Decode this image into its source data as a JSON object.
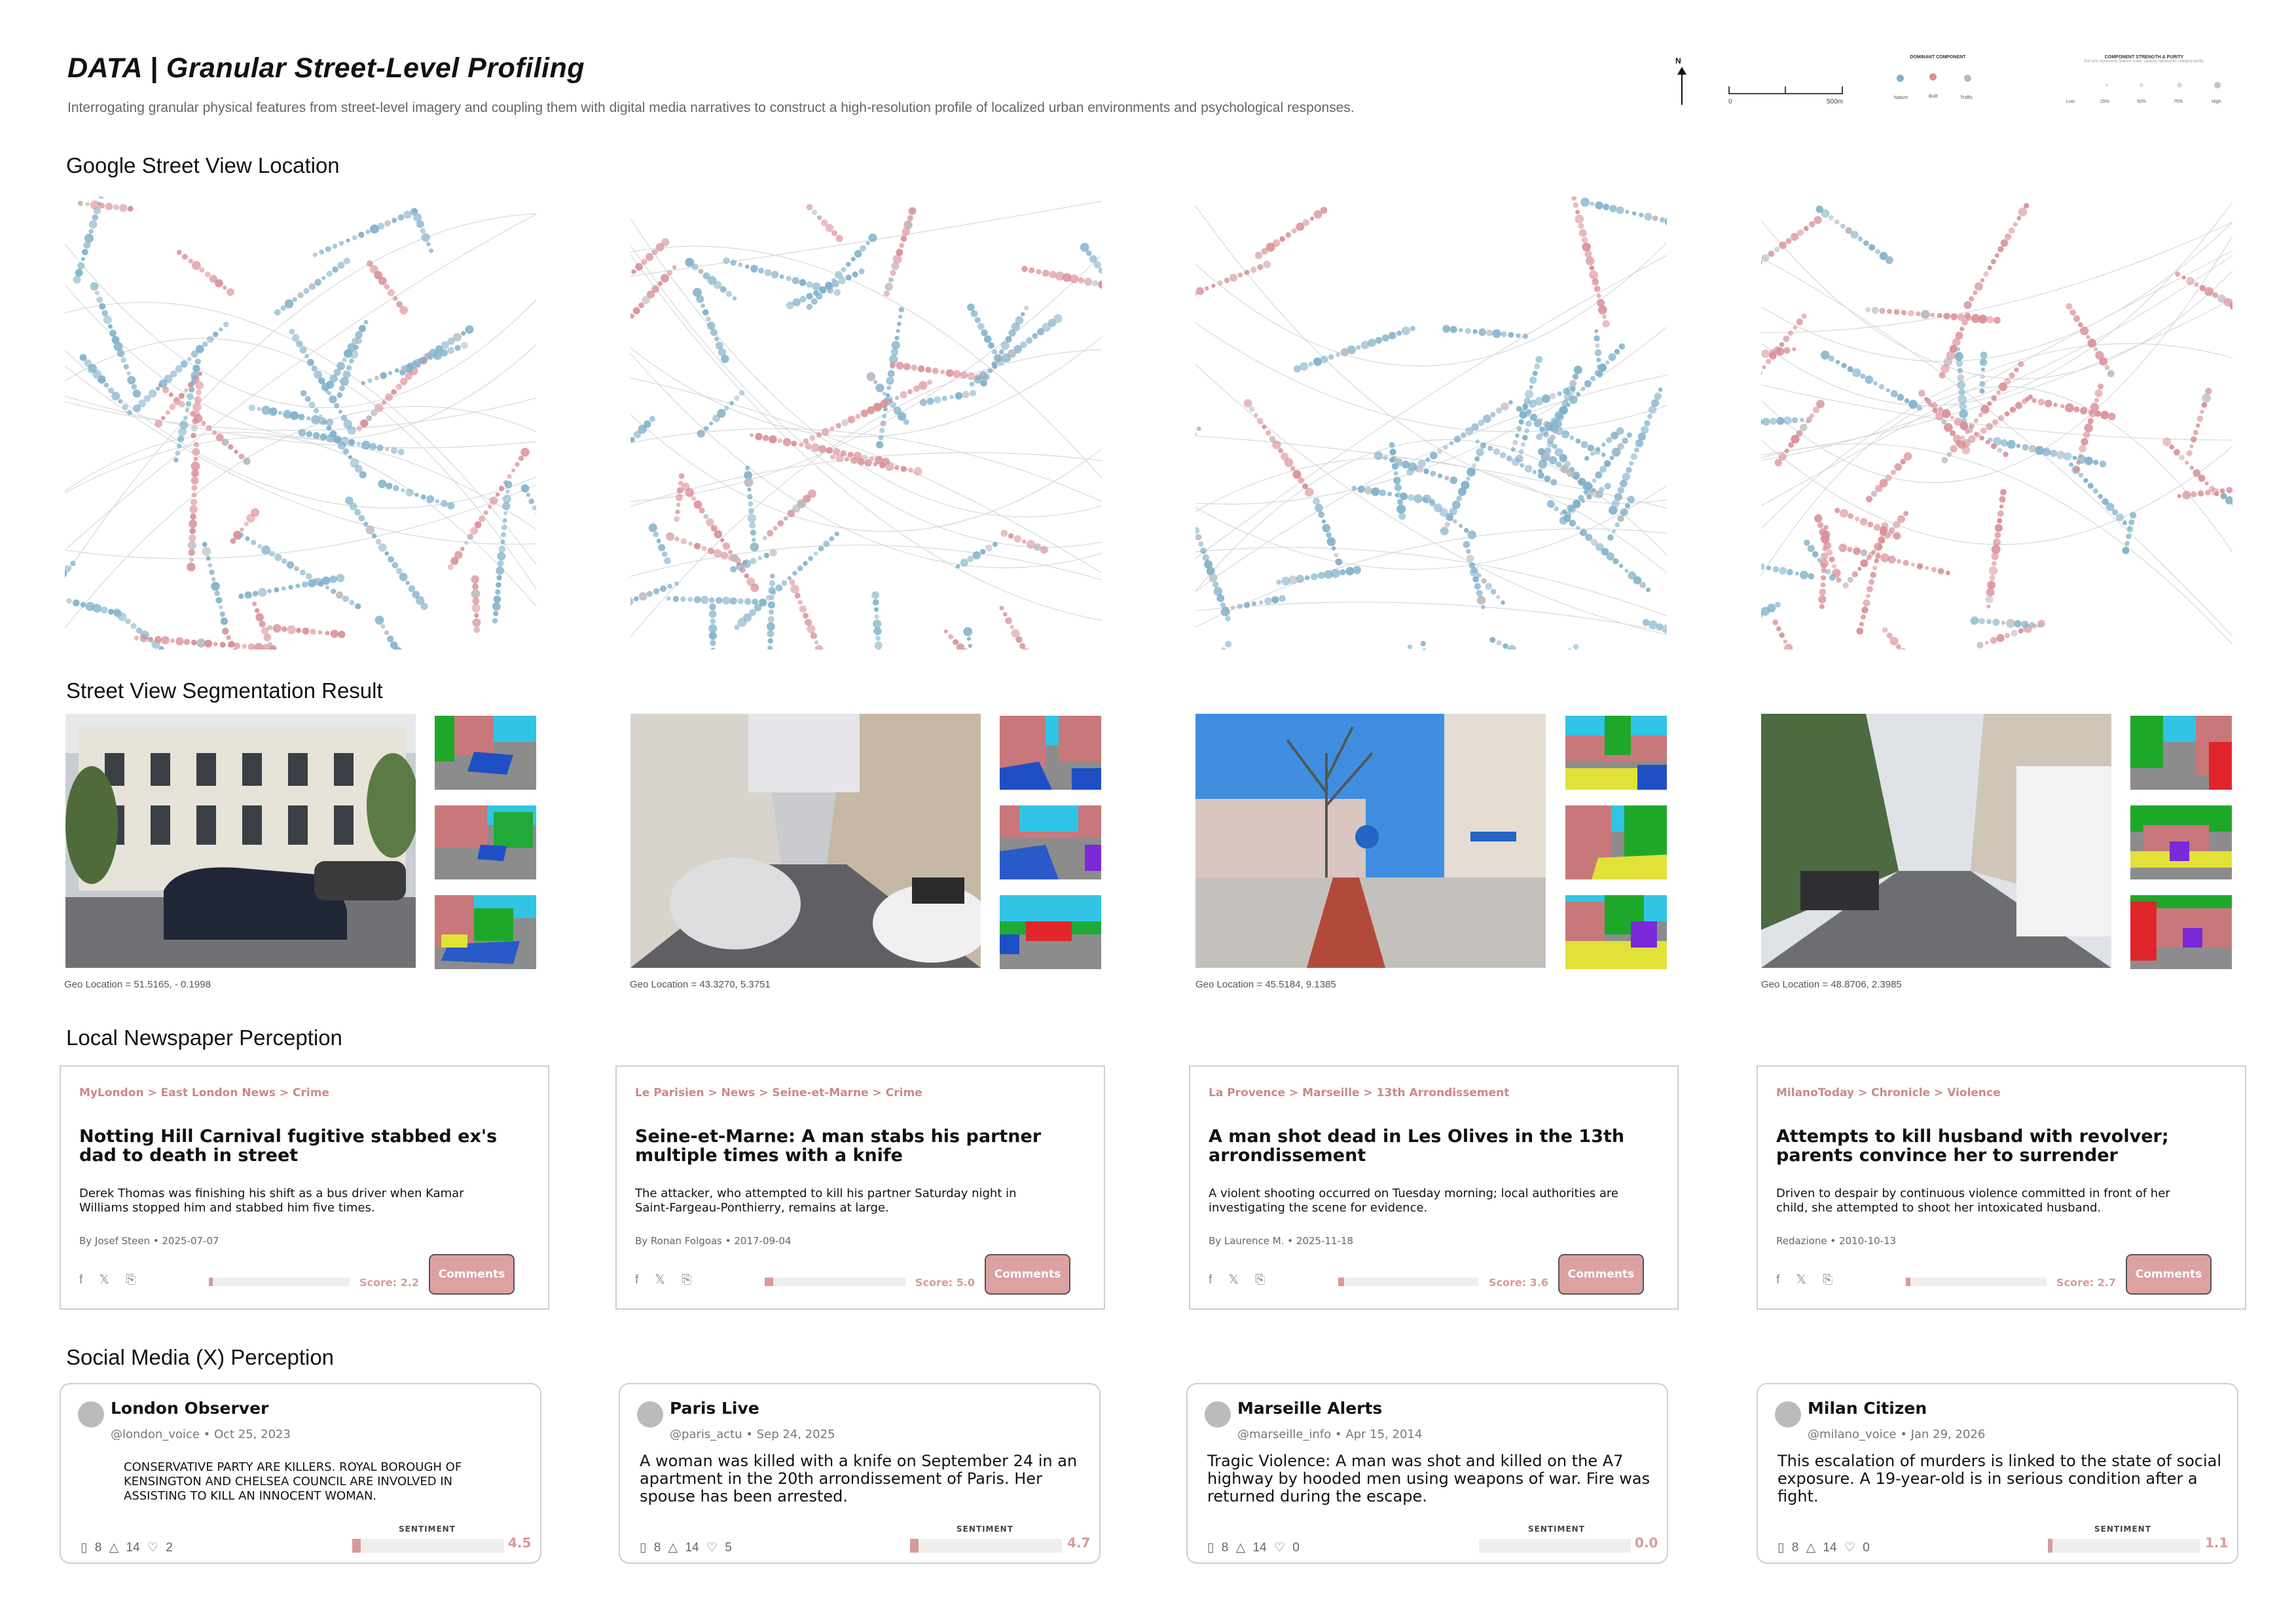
{
  "header": {
    "title": "DATA | Granular Street-Level Profiling",
    "subtitle": "Interrogating granular physical features from street-level imagery and coupling them with digital media narratives to construct a high-resolution profile of localized urban environments and psychological responses."
  },
  "legend": {
    "north": "N",
    "scale_start": "0",
    "scale_end": "500m",
    "dominant_title": "DOMINANT COMPONENT",
    "dominant_items": [
      "Nature",
      "Built",
      "Traffic"
    ],
    "strength_title": "COMPONENT STRENGTH & PURITY",
    "strength_subtitle": "Dot size represents feature scale; Opacity represents category purity.",
    "strength_items": [
      "Low",
      "25%",
      "50%",
      "75%",
      "High"
    ],
    "colors": {
      "nature": "#7fb0c9",
      "built": "#d98f96",
      "traffic": "#b9b9bd"
    }
  },
  "sections": {
    "gsv": "Google Street View Location",
    "segmentation": "Street View Segmentation Result",
    "newspaper": "Local Newspaper Perception",
    "social": "Social Media (X) Perception"
  },
  "geo_locations": [
    "Geo Location = 51.5165, - 0.1998",
    "Geo Location = 43.3270, 5.3751",
    "Geo Location = 45.5184, 9.1385",
    "Geo Location = 48.8706, 2.3985"
  ],
  "news": [
    {
      "crumb": "MyLondon > East London News > Crime",
      "headline": "Notting Hill Carnival fugitive stabbed ex's dad to death in street",
      "desc": "Derek Thomas was finishing his shift as a bus driver when Kamar Williams stopped him and stabbed him five times.",
      "byline": "By Josef Steen • 2025-07-07",
      "share": "f 𝕏 ⎘",
      "score_label": "Score: 2.2",
      "score": 2.2,
      "button": "Comments"
    },
    {
      "crumb": "Le Parisien > News > Seine-et-Marne > Crime",
      "headline": "Seine-et-Marne: A man stabs his partner multiple times with a knife",
      "desc": "The attacker, who attempted to kill his partner Saturday night in Saint-Fargeau-Ponthierry, remains at large.",
      "byline": "By Ronan Folgoas • 2017-09-04",
      "share": "f 𝕏 ⎘",
      "score_label": "Score: 5.0",
      "score": 5.0,
      "button": "Comments"
    },
    {
      "crumb": "La Provence > Marseille > 13th Arrondissement",
      "headline": "A man shot dead in Les Olives in the 13th arrondissement",
      "desc": "A violent shooting occurred on Tuesday morning; local authorities are investigating the scene for evidence.",
      "byline": "By Laurence M. • 2025-11-18",
      "share": "f 𝕏 ⎘",
      "score_label": "Score: 3.6",
      "score": 3.6,
      "button": "Comments"
    },
    {
      "crumb": "MilanoToday > Chronicle > Violence",
      "headline": "Attempts to kill husband with revolver; parents convince her to surrender",
      "desc": "Driven to despair by continuous violence committed in front of her child, she attempted to shoot her intoxicated husband.",
      "byline": "Redazione • 2010-10-13",
      "share": "f 𝕏 ⎘",
      "score_label": "Score: 2.7",
      "score": 2.7,
      "button": "Comments"
    }
  ],
  "posts": [
    {
      "name": "London Observer",
      "handle": "@london_voice • Oct 25, 2023",
      "text": "CONSERVATIVE PARTY ARE KILLERS. ROYAL BOROUGH OF KENSINGTON AND CHELSEA COUNCIL ARE INVOLVED IN ASSISTING TO KILL AN INNOCENT WOMAN.",
      "actions": "▯ 8   △ 14   ♡ 2",
      "sentiment_label": "SENTIMENT",
      "sentiment_value": "4.5",
      "sentiment": 4.5
    },
    {
      "name": "Paris Live",
      "handle": "@paris_actu • Sep 24, 2025",
      "text": "A woman was killed with a knife on September 24 in an apartment in the 20th arrondissement of Paris. Her spouse has been arrested.",
      "actions": "▯ 8   △ 14   ♡ 5",
      "sentiment_label": "SENTIMENT",
      "sentiment_value": "4.7",
      "sentiment": 4.7
    },
    {
      "name": "Marseille Alerts",
      "handle": "@marseille_info • Apr 15, 2014",
      "text": "Tragic Violence: A man was shot and killed on the A7 highway by hooded men using weapons of war. Fire was returned during the escape.",
      "actions": "▯ 8   △ 14   ♡ 0",
      "sentiment_label": "SENTIMENT",
      "sentiment_value": "0.0",
      "sentiment": 0.0
    },
    {
      "name": "Milan Citizen",
      "handle": "@milano_voice • Jan 29, 2026",
      "text": "This escalation of murders is linked to the state of social exposure. A 19-year-old is in serious condition after a fight.",
      "actions": "▯ 8   △ 14   ♡ 0",
      "sentiment_label": "SENTIMENT",
      "sentiment_value": "1.1",
      "sentiment": 1.1
    }
  ]
}
